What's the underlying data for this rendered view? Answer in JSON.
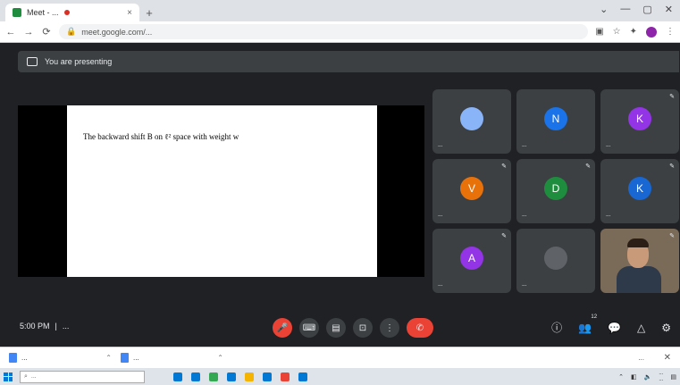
{
  "browser": {
    "tab_title": "Meet - ...",
    "tab_close": "×",
    "new_tab": "+",
    "window_controls": [
      "⌄",
      "—",
      "▢",
      "✕"
    ],
    "url": "meet.google.com/...",
    "nav": [
      "←",
      "→",
      "⟳"
    ]
  },
  "meet": {
    "banner_text": "You are presenting",
    "slide_text": "The backward shift B",
    "slide_formula": "on ℓ² space with weight w",
    "tiles": [
      {
        "initial": "",
        "name": "...",
        "color": "#8ab4f8",
        "mic": "",
        "kind": "photo"
      },
      {
        "initial": "N",
        "name": "...",
        "color": "#1a73e8",
        "mic": "",
        "kind": "initial"
      },
      {
        "initial": "K",
        "name": "...",
        "color": "#9334e6",
        "mic": "✎",
        "kind": "initial"
      },
      {
        "initial": "V",
        "name": "...",
        "color": "#e8710a",
        "mic": "✎",
        "kind": "initial"
      },
      {
        "initial": "D",
        "name": "...",
        "color": "#1e8e3e",
        "mic": "✎",
        "kind": "initial"
      },
      {
        "initial": "K",
        "name": "...",
        "color": "#1967d2",
        "mic": "✎",
        "kind": "initial"
      },
      {
        "initial": "A",
        "name": "...",
        "color": "#9334e6",
        "mic": "✎",
        "kind": "initial"
      },
      {
        "initial": "",
        "name": "...",
        "color": "#5f6368",
        "mic": "",
        "kind": "others"
      },
      {
        "initial": "",
        "name": "",
        "color": "",
        "mic": "✎",
        "kind": "video"
      }
    ]
  },
  "bottom": {
    "time": "5:00 PM",
    "separator": "|",
    "meeting_code": "...",
    "controls": [
      "🎤",
      "⌨",
      "▤",
      "⊡",
      "⋮",
      "✆"
    ],
    "right_controls": [
      "ⓘ",
      "👥",
      "💬",
      "△",
      "⚙"
    ],
    "people_count": "12"
  },
  "downloads": {
    "items": [
      "...",
      "..."
    ],
    "show_all": "...",
    "close": "✕"
  },
  "taskbar": {
    "search_placeholder": "...",
    "time": "...",
    "date": "...",
    "app_colors": [
      "#0078d4",
      "#0078d4",
      "#34a853",
      "#0078d4",
      "#f4b400",
      "#0078d4",
      "#ea4335",
      "#0078d4"
    ]
  }
}
